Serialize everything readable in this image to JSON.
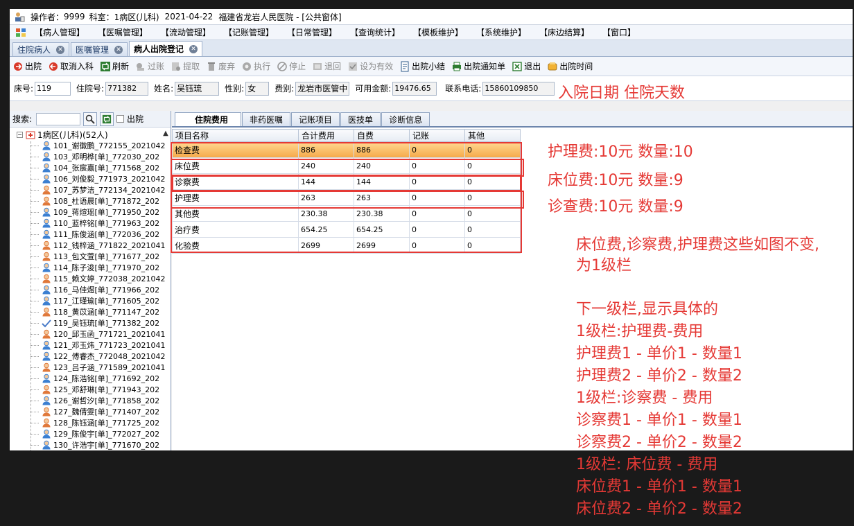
{
  "title": {
    "operator_label": "操作者：",
    "operator": "9999",
    "dept_label": "科室：",
    "dept": "1病区(儿科)",
    "date": "2021-04-22",
    "hospital": "福建省龙岩人民医院 - [公共窗体]"
  },
  "menu": [
    "【病人管理】",
    "【医嘱管理】",
    "【流动管理】",
    "【记账管理】",
    "【日常管理】",
    "【查询统计】",
    "【模板维护】",
    "【系统维护】",
    "【床边结算】",
    "【窗口】"
  ],
  "doc_tabs": [
    {
      "label": "住院病人",
      "active": false
    },
    {
      "label": "医嘱管理",
      "active": false
    },
    {
      "label": "病人出院登记",
      "active": true
    }
  ],
  "toolbar": [
    {
      "label": "出院",
      "icon": "discharge-icon",
      "enabled": true
    },
    {
      "label": "取消入科",
      "icon": "cancel-admit-icon",
      "enabled": true
    },
    {
      "label": "刷新",
      "icon": "refresh-icon",
      "enabled": true
    },
    {
      "label": "过账",
      "icon": "post-icon",
      "enabled": false
    },
    {
      "label": "提取",
      "icon": "extract-icon",
      "enabled": false
    },
    {
      "label": "废弃",
      "icon": "trash-icon",
      "enabled": false
    },
    {
      "label": "执行",
      "icon": "execute-icon",
      "enabled": false
    },
    {
      "label": "停止",
      "icon": "stop-icon",
      "enabled": false
    },
    {
      "label": "退回",
      "icon": "return-icon",
      "enabled": false
    },
    {
      "label": "设为有效",
      "icon": "validate-icon",
      "enabled": false
    },
    {
      "label": "出院小结",
      "icon": "summary-icon",
      "enabled": true
    },
    {
      "label": "出院通知单",
      "icon": "print-notice-icon",
      "enabled": true
    },
    {
      "label": "退出",
      "icon": "exit-icon",
      "enabled": true
    },
    {
      "label": "出院时间",
      "icon": "clock-icon",
      "enabled": true
    }
  ],
  "patient": {
    "bed_label": "床号:",
    "bed": "119",
    "admission_no_label": "住院号:",
    "admission_no": "771382",
    "name_label": "姓名:",
    "name": "吴钰琉",
    "sex_label": "性别:",
    "sex": "女",
    "fee_type_label": "费别:",
    "fee_type": "龙岩市医管中",
    "balance_label": "可用金额:",
    "balance": "19476.65",
    "phone_label": "联系电话:",
    "phone": "15860109850"
  },
  "annotation_header": "入院日期 住院天数",
  "search": {
    "label": "搜索:",
    "discharged_label": "出院"
  },
  "tree": {
    "root": "1病区(儿科)(52人)",
    "items": [
      {
        "label": "101_谢徽鹏_772155_2021042",
        "gender": "m"
      },
      {
        "label": "103_邓明桦[单]_772030_202",
        "gender": "m"
      },
      {
        "label": "104_张宸嘉[单]_771568_202",
        "gender": "m"
      },
      {
        "label": "106_刘俊毅_771973_2021042",
        "gender": "m"
      },
      {
        "label": "107_苏梦洁_772134_2021042",
        "gender": "f"
      },
      {
        "label": "108_杜语晨[单]_771872_202",
        "gender": "f"
      },
      {
        "label": "109_蒋煊瑶[单]_771950_202",
        "gender": "m"
      },
      {
        "label": "110_蓝梓铭[单]_771963_202",
        "gender": "m"
      },
      {
        "label": "111_陈俊涵[单]_772036_202",
        "gender": "m"
      },
      {
        "label": "112_钱梓涵_771822_2021041",
        "gender": "f"
      },
      {
        "label": "113_包文萱[单]_771677_202",
        "gender": "f"
      },
      {
        "label": "114_陈子浚[单]_771970_202",
        "gender": "m"
      },
      {
        "label": "115_赖文婷_772038_2021042",
        "gender": "f"
      },
      {
        "label": "116_马佳煜[单]_771966_202",
        "gender": "m"
      },
      {
        "label": "117_江瑾瑜[单]_771605_202",
        "gender": "m"
      },
      {
        "label": "118_黄苡涵[单]_771147_202",
        "gender": "f"
      },
      {
        "label": "119_吴钰琉[单]_771382_202",
        "gender": "check"
      },
      {
        "label": "120_邱玉函_771721_2021041",
        "gender": "f"
      },
      {
        "label": "121_邓玉炜_771723_2021041",
        "gender": "m"
      },
      {
        "label": "122_傅睿杰_772048_2021042",
        "gender": "m"
      },
      {
        "label": "123_吕子涵_771589_2021041",
        "gender": "f"
      },
      {
        "label": "124_陈浩铭[单]_771692_202",
        "gender": "m"
      },
      {
        "label": "125_邓舒琳[单]_771943_202",
        "gender": "f"
      },
      {
        "label": "126_谢哲汐[单]_771858_202",
        "gender": "m"
      },
      {
        "label": "127_魏倩雯[单]_771407_202",
        "gender": "f"
      },
      {
        "label": "128_陈钰涵[单]_771725_202",
        "gender": "f"
      },
      {
        "label": "129_陈俊宇[单]_772027_202",
        "gender": "m"
      },
      {
        "label": "130_许浩宇[单]_771670_202",
        "gender": "m"
      }
    ]
  },
  "sub_tabs": [
    {
      "label": "住院费用",
      "active": true
    },
    {
      "label": "非药医嘱",
      "active": false
    },
    {
      "label": "记账项目",
      "active": false
    },
    {
      "label": "医技单",
      "active": false
    },
    {
      "label": "诊断信息",
      "active": false
    }
  ],
  "fee_table": {
    "columns": [
      "项目名称",
      "合计费用",
      "自费",
      "记账",
      "其他"
    ],
    "rows": [
      [
        "检查费",
        "886",
        "886",
        "0",
        "0"
      ],
      [
        "床位费",
        "240",
        "240",
        "0",
        "0"
      ],
      [
        "诊察费",
        "144",
        "144",
        "0",
        "0"
      ],
      [
        "护理费",
        "263",
        "263",
        "0",
        "0"
      ],
      [
        "其他费",
        "230.38",
        "230.38",
        "0",
        "0"
      ],
      [
        "治疗费",
        "654.25",
        "654.25",
        "0",
        "0"
      ],
      [
        "化验费",
        "2699",
        "2699",
        "0",
        "0"
      ]
    ],
    "selected_row": 0
  },
  "annotations_right": [
    "护理费:10元  数量:10",
    "床位费:10元  数量:9",
    "诊查费:10元  数量:9"
  ],
  "annotations_note": [
    "床位费,诊察费,护理费这些如图不变,",
    "为1级栏",
    "",
    "下一级栏,显示具体的",
    "1级栏:护理费-费用",
    "护理费1 - 单价1 - 数量1",
    "护理费2 - 单价2 - 数量2",
    "1级栏:诊察费 - 费用",
    "诊察费1 - 单价1 - 数量1",
    "诊察费2 - 单价2 - 数量2",
    "1级栏: 床位费 - 费用",
    "床位费1 - 单价1 - 数量1",
    "床位费2 - 单价2 - 数量2"
  ],
  "colors": {
    "annotation": "#e53935",
    "selected_row": "#f5a94a",
    "male_icon": "#3b7fd1",
    "female_icon": "#e0783a"
  }
}
